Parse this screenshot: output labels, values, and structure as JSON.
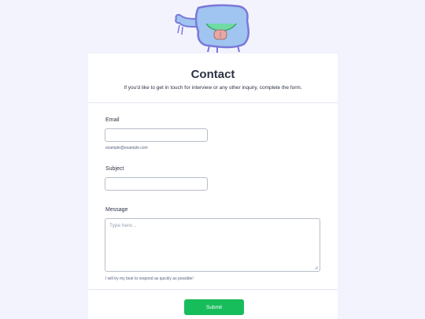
{
  "form": {
    "title": "Contact",
    "subtitle": "If you'd like to get in touch for interview or any other inquiry, complete the form.",
    "email": {
      "label": "Email",
      "value": "",
      "sublabel": "example@example.com"
    },
    "subject": {
      "label": "Subject",
      "value": ""
    },
    "message": {
      "label": "Message",
      "placeholder": "Type here...",
      "sublabel": "I will try my best to respond as quickly as possible!"
    },
    "submit_label": "Submit"
  },
  "colors": {
    "background": "#f3f3fe",
    "card": "#ffffff",
    "submit": "#18bd5b",
    "text": "#2c3345"
  },
  "icons": {
    "logo": "monster-mascot-logo"
  }
}
